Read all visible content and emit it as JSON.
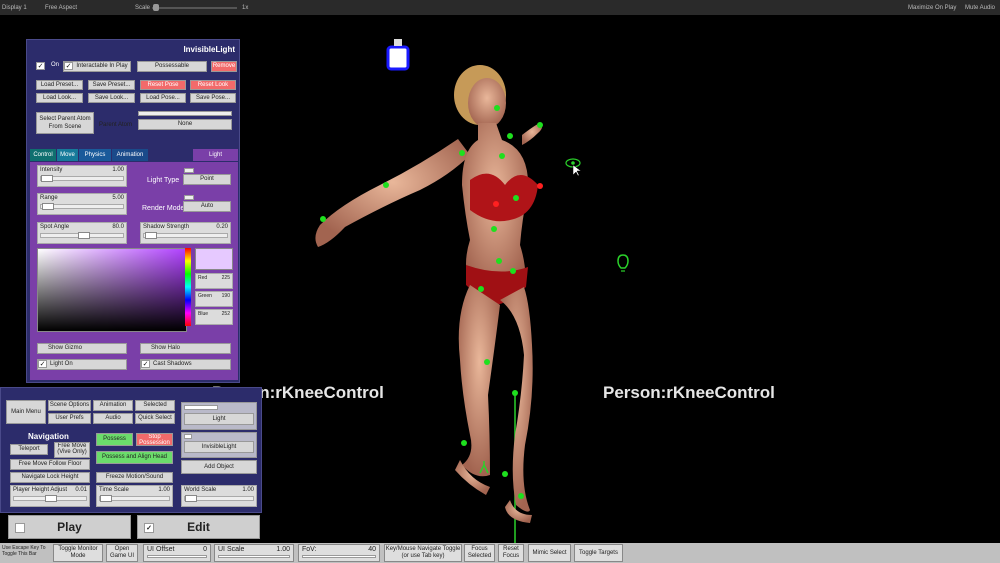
{
  "unity_bar": {
    "display": "Display 1",
    "aspect": "Free Aspect",
    "scale_label": "Scale",
    "scale_value": "1x",
    "maximize": "Maximize On Play",
    "mute": "Mute Audio"
  },
  "light_panel": {
    "title": "InvisibleLight",
    "on_label": "On",
    "on_checked": "✓",
    "interactable_label": "Interactable In Play",
    "interactable_checked": "✓",
    "possessable_label": "Possessable",
    "remove_label": "Remove",
    "row1": [
      "Load Preset...",
      "Save Preset...",
      "Reset Pose",
      "Reset Look"
    ],
    "row2": [
      "Load Look...",
      "Save Look...",
      "Load Pose...",
      "Save Pose..."
    ],
    "select_parent": "Select Parent Atom From Scene",
    "parent_atom_label": "Parent Atom",
    "parent_atom_value": "None",
    "tabs": [
      "Control",
      "Move",
      "Physics",
      "Animation"
    ],
    "light_tab": "Light",
    "intensity": {
      "label": "Intensity",
      "value": "1.00"
    },
    "range": {
      "label": "Range",
      "value": "5.00"
    },
    "spot_angle": {
      "label": "Spot Angle",
      "value": "80.0"
    },
    "shadow_strength": {
      "label": "Shadow Strength",
      "value": "0.20"
    },
    "light_type_label": "Light Type",
    "light_type_value": "Point",
    "render_mode_label": "Render Mode",
    "render_mode_value": "Auto",
    "red": {
      "label": "Red",
      "value": "225"
    },
    "green": {
      "label": "Green",
      "value": "190"
    },
    "blue": {
      "label": "Blue",
      "value": "252"
    },
    "show_gizmo": "Show Gizmo",
    "show_halo": "Show Halo",
    "light_on": "Light On",
    "light_on_checked": "✓",
    "cast_shadows": "Cast Shadows",
    "cast_shadows_checked": "✓"
  },
  "main_menu": {
    "main_menu": "Main Menu",
    "scene_options": "Scene Options",
    "animation": "Animation",
    "selected": "Selected",
    "user_prefs": "User Prefs",
    "audio": "Audio",
    "quick_select": "Quick Select",
    "navigation": "Navigation",
    "teleport": "Teleport",
    "free_move": "Free Move (Vive Only)",
    "possess": "Possess",
    "stop_possession": "Stop Possession",
    "free_move_follow_floor": "Free Move Follow Floor",
    "possess_align_head": "Possess and Align Head",
    "navigate_lock_height": "Navigate Lock Height",
    "freeze_motion": "Freeze Motion/Sound",
    "player_height_label": "Player Height Adjust",
    "player_height_value": "0.01",
    "time_scale_label": "Time Scale",
    "time_scale_value": "1.00",
    "light": "Light",
    "invisible_light": "InvisibleLight",
    "add_object": "Add Object",
    "world_scale_label": "World Scale",
    "world_scale_value": "1.00"
  },
  "play_label": "Play",
  "edit_label": "Edit",
  "edit_checked": "✓",
  "scene": {
    "label_left": "Person:rKneeControl",
    "label_right": "Person:rKneeControl"
  },
  "bottom_bar": {
    "escape_hint": "Use Escape Key To Toggle This Bar",
    "toggle_monitor": "Toggle Monitor Mode",
    "open_game_ui": "Open Game UI",
    "ui_offset_label": "UI Offset",
    "ui_offset_value": "0",
    "ui_scale_label": "UI Scale",
    "ui_scale_value": "1.00",
    "fov_label": "FoV:",
    "fov_value": "40",
    "keymouse": "Key/Mouse Navigate Toggle (or use Tab key)",
    "focus_selected": "Focus Selected",
    "reset_focus": "Reset Focus",
    "mimic_select": "Mimic Select",
    "toggle_targets": "Toggle Targets"
  }
}
